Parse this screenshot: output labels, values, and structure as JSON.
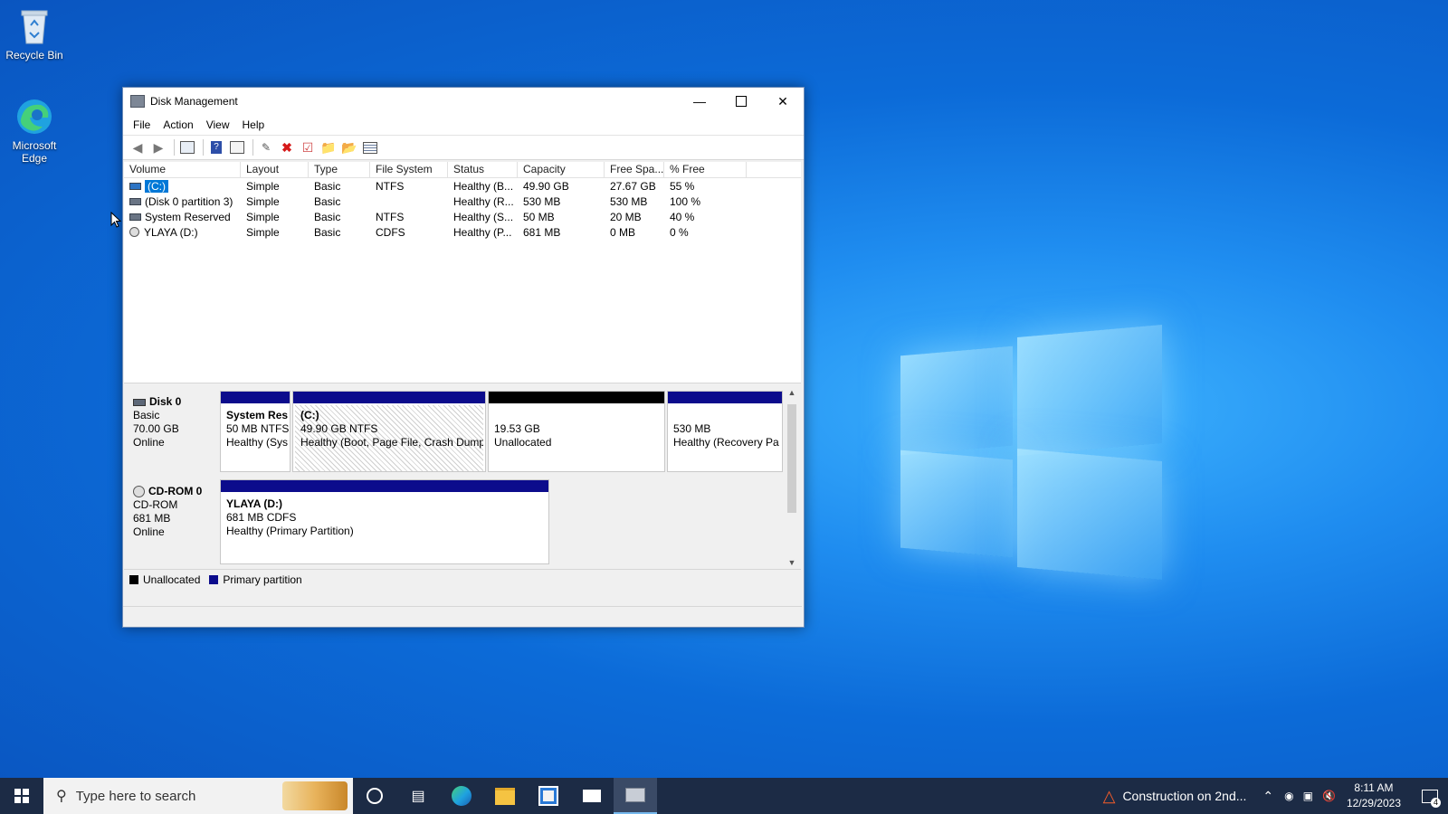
{
  "desktop": {
    "icons": [
      {
        "label": "Recycle Bin"
      },
      {
        "label": "Microsoft Edge"
      }
    ]
  },
  "window": {
    "title": "Disk Management",
    "menu": [
      "File",
      "Action",
      "View",
      "Help"
    ],
    "columns": [
      "Volume",
      "Layout",
      "Type",
      "File System",
      "Status",
      "Capacity",
      "Free Spa...",
      "% Free"
    ],
    "volumes": [
      {
        "volume": "(C:)",
        "layout": "Simple",
        "type": "Basic",
        "fs": "NTFS",
        "status": "Healthy (B...",
        "capacity": "49.90 GB",
        "free": "27.67 GB",
        "pct": "55 %"
      },
      {
        "volume": "(Disk 0 partition 3)",
        "layout": "Simple",
        "type": "Basic",
        "fs": "",
        "status": "Healthy (R...",
        "capacity": "530 MB",
        "free": "530 MB",
        "pct": "100 %"
      },
      {
        "volume": "System Reserved",
        "layout": "Simple",
        "type": "Basic",
        "fs": "NTFS",
        "status": "Healthy (S...",
        "capacity": "50 MB",
        "free": "20 MB",
        "pct": "40 %"
      },
      {
        "volume": "YLAYA (D:)",
        "layout": "Simple",
        "type": "Basic",
        "fs": "CDFS",
        "status": "Healthy (P...",
        "capacity": "681 MB",
        "free": "0 MB",
        "pct": "0 %"
      }
    ],
    "disk0": {
      "name": "Disk 0",
      "kind": "Basic",
      "size": "70.00 GB",
      "state": "Online",
      "partitions": [
        {
          "title": "System Res",
          "line2": "50 MB NTFS",
          "line3": "Healthy (Sys"
        },
        {
          "title": "(C:)",
          "line2": "49.90 GB NTFS",
          "line3": "Healthy (Boot, Page File, Crash Dump,"
        },
        {
          "title": "",
          "line2": "19.53 GB",
          "line3": "Unallocated"
        },
        {
          "title": "",
          "line2": "530 MB",
          "line3": "Healthy (Recovery Pa"
        }
      ]
    },
    "cdrom0": {
      "name": "CD-ROM 0",
      "kind": "CD-ROM",
      "size": "681 MB",
      "state": "Online",
      "partition": {
        "title": "YLAYA  (D:)",
        "line2": "681 MB CDFS",
        "line3": "Healthy (Primary Partition)"
      }
    },
    "legend": [
      {
        "label": "Unallocated",
        "color": "#000000"
      },
      {
        "label": "Primary partition",
        "color": "#0c0c8c"
      }
    ]
  },
  "taskbar": {
    "search_placeholder": "Type here to search",
    "weather": "Construction on 2nd...",
    "time": "8:11 AM",
    "date": "12/29/2023",
    "notification_count": "4"
  }
}
